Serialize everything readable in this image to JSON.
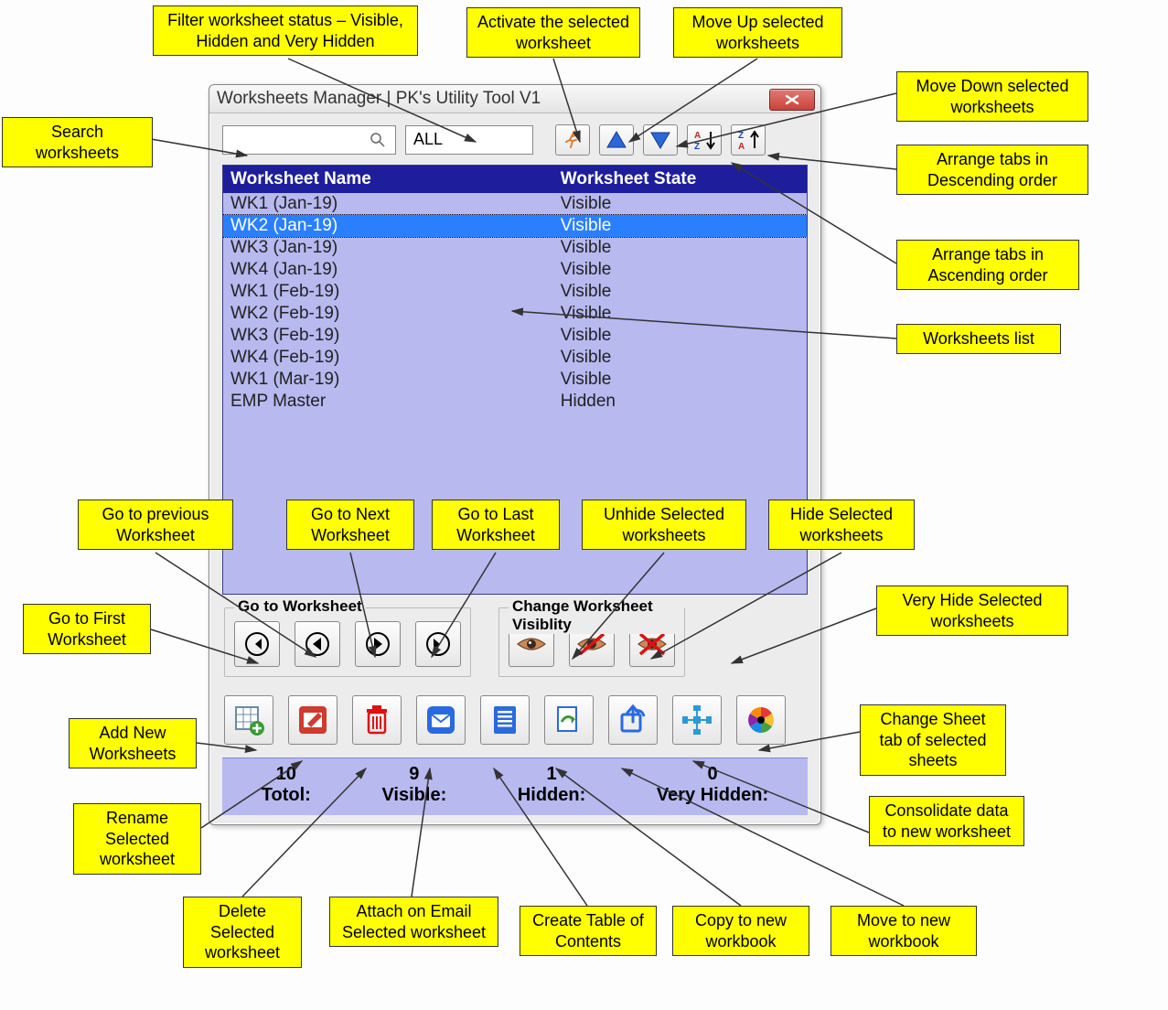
{
  "title": "Worksheets Manager | PK's Utility Tool V1",
  "search": {
    "value": ""
  },
  "filter": {
    "value": "ALL"
  },
  "headers": {
    "name": "Worksheet Name",
    "state": "Worksheet State"
  },
  "rows": [
    {
      "name": "WK1 (Jan-19)",
      "state": "Visible",
      "selected": false
    },
    {
      "name": "WK2 (Jan-19)",
      "state": "Visible",
      "selected": true
    },
    {
      "name": "WK3 (Jan-19)",
      "state": "Visible",
      "selected": false
    },
    {
      "name": "WK4 (Jan-19)",
      "state": "Visible",
      "selected": false
    },
    {
      "name": "WK1 (Feb-19)",
      "state": "Visible",
      "selected": false
    },
    {
      "name": "WK2 (Feb-19)",
      "state": "Visible",
      "selected": false
    },
    {
      "name": "WK3 (Feb-19)",
      "state": "Visible",
      "selected": false
    },
    {
      "name": "WK4 (Feb-19)",
      "state": "Visible",
      "selected": false
    },
    {
      "name": "WK1 (Mar-19)",
      "state": "Visible",
      "selected": false
    },
    {
      "name": "EMP Master",
      "state": "Hidden",
      "selected": false
    }
  ],
  "groups": {
    "goto": "Go to Worksheet",
    "visibility": "Change Worksheet Visiblity"
  },
  "stats": {
    "total": {
      "value": "10",
      "label": "Totol:"
    },
    "visible": {
      "value": "9",
      "label": "Visible:"
    },
    "hidden": {
      "value": "1",
      "label": "Hidden:"
    },
    "veryhidden": {
      "value": "0",
      "label": "Very Hidden:"
    }
  },
  "callouts": {
    "search": "Search worksheets",
    "filter": "Filter worksheet status – Visible, Hidden and Very Hidden",
    "activate": "Activate the selected worksheet",
    "moveup": "Move Up selected worksheets",
    "movedown": "Move Down selected worksheets",
    "sortdesc": "Arrange tabs in Descending order",
    "sortasc": "Arrange tabs in Ascending order",
    "list": "Worksheets list",
    "goprev": "Go to previous Worksheet",
    "gonext": "Go to Next Worksheet",
    "golast": "Go to Last Worksheet",
    "gofirst": "Go to First Worksheet",
    "unhide": "Unhide Selected worksheets",
    "hide": "Hide Selected worksheets",
    "veryhide": "Very Hide Selected worksheets",
    "addnew": "Add New Worksheets",
    "rename": "Rename Selected worksheet",
    "delete": "Delete Selected worksheet",
    "email": "Attach on Email Selected worksheet",
    "toc": "Create Table of Contents",
    "copynew": "Copy to new workbook",
    "movenew": "Move to new workbook",
    "consolidate": "Consolidate data to new worksheet",
    "tabcolor": "Change Sheet tab of selected sheets"
  }
}
